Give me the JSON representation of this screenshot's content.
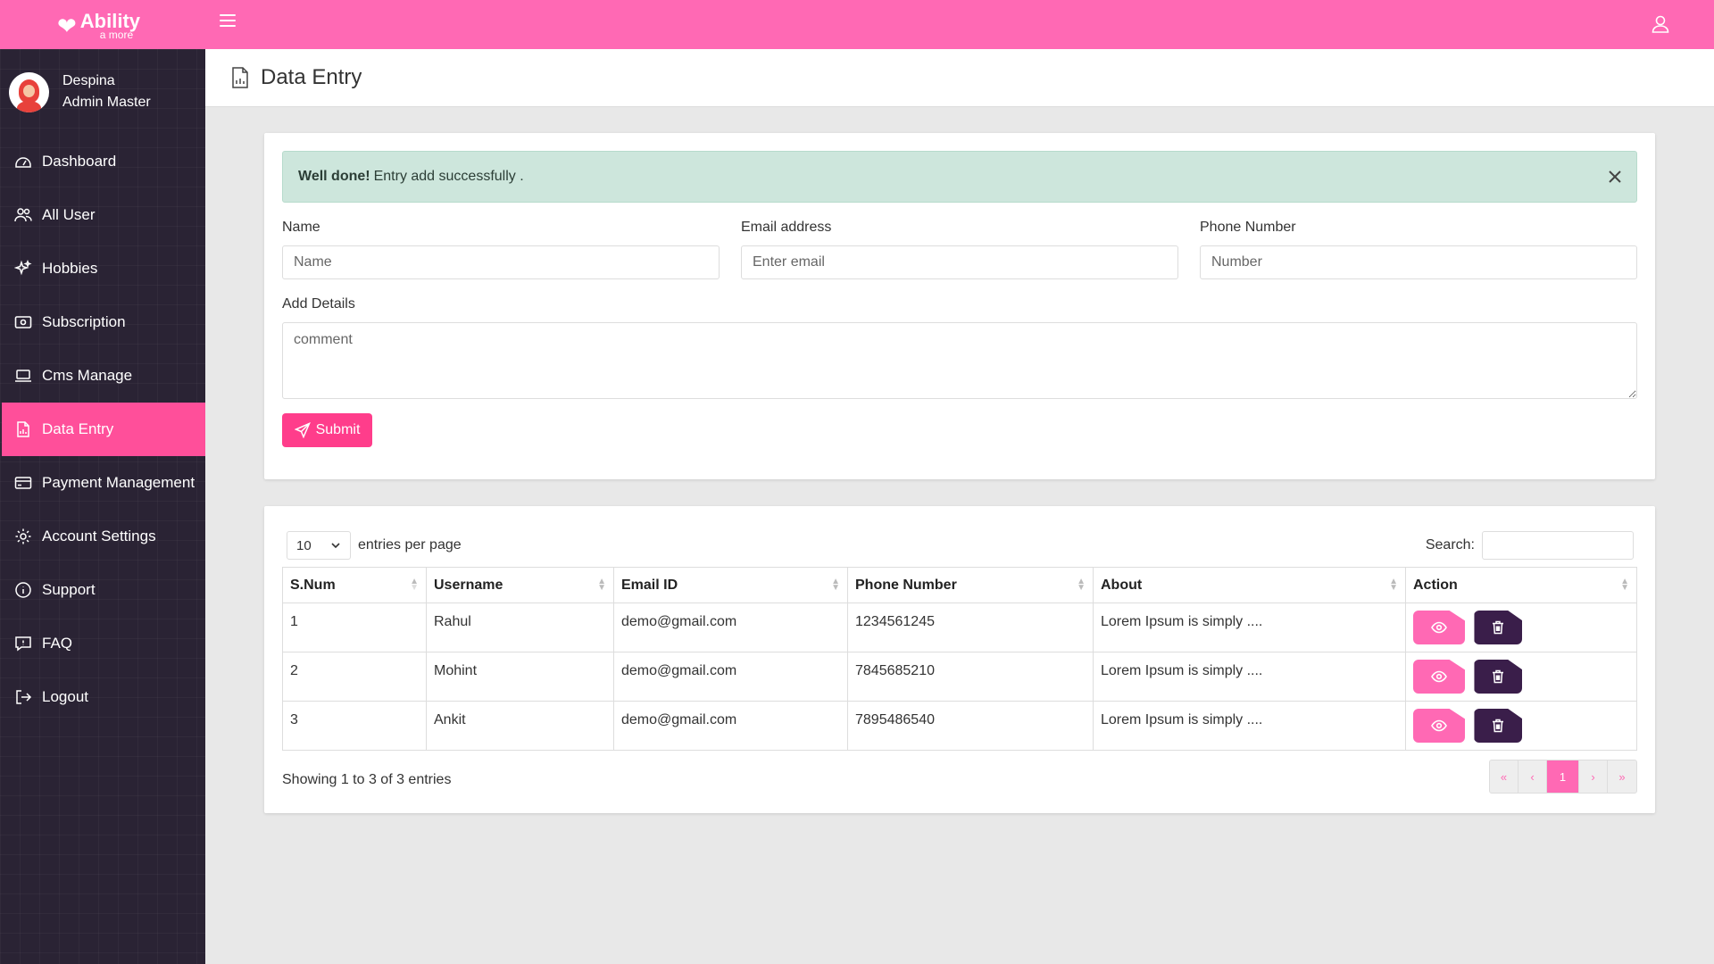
{
  "app": {
    "logo_main": "Ability",
    "logo_sub": "a more"
  },
  "user": {
    "name": "Despina",
    "role": "Admin Master"
  },
  "sidebar": {
    "items": [
      {
        "label": "Dashboard",
        "icon": "dashboard-icon"
      },
      {
        "label": "All User",
        "icon": "users-icon"
      },
      {
        "label": "Hobbies",
        "icon": "sparkles-icon"
      },
      {
        "label": "Subscription",
        "icon": "money-icon"
      },
      {
        "label": "Cms Manage",
        "icon": "laptop-icon"
      },
      {
        "label": "Data Entry",
        "icon": "document-icon",
        "active": true
      },
      {
        "label": "Payment Management",
        "icon": "card-icon"
      },
      {
        "label": "Account Settings",
        "icon": "gear-icon"
      },
      {
        "label": "Support",
        "icon": "info-icon"
      },
      {
        "label": "FAQ",
        "icon": "chat-icon"
      },
      {
        "label": "Logout",
        "icon": "logout-icon"
      }
    ]
  },
  "page": {
    "title": "Data Entry"
  },
  "alert": {
    "strong": "Well done!",
    "message": "Entry add successfully ."
  },
  "form": {
    "name_label": "Name",
    "name_placeholder": "Name",
    "email_label": "Email address",
    "email_placeholder": "Enter email",
    "phone_label": "Phone Number",
    "phone_placeholder": "Number",
    "details_label": "Add Details",
    "details_placeholder": "comment",
    "submit_label": "Submit"
  },
  "table_controls": {
    "per_page_value": "10",
    "per_page_label": "entries per page",
    "search_label": "Search:"
  },
  "table": {
    "headers": [
      "S.Num",
      "Username",
      "Email ID",
      "Phone Number",
      "About",
      "Action"
    ],
    "rows": [
      {
        "num": "1",
        "username": "Rahul",
        "email": "demo@gmail.com",
        "phone": "1234561245",
        "about": "Lorem Ipsum is simply ...."
      },
      {
        "num": "2",
        "username": "Mohint",
        "email": "demo@gmail.com",
        "phone": "7845685210",
        "about": "Lorem Ipsum is simply ...."
      },
      {
        "num": "3",
        "username": "Ankit",
        "email": "demo@gmail.com",
        "phone": "7895486540",
        "about": "Lorem Ipsum is simply ...."
      }
    ]
  },
  "footer": {
    "showing": "Showing 1 to 3 of 3 entries"
  },
  "pagination": {
    "first": "«",
    "prev": "‹",
    "current": "1",
    "next": "›",
    "last": "»"
  },
  "colors": {
    "accent": "#ff69b4",
    "active": "#ff4f9a",
    "sidebar_bg": "#2a2334",
    "delete_btn": "#3a1e4a",
    "alert_bg": "#cde6dc"
  }
}
